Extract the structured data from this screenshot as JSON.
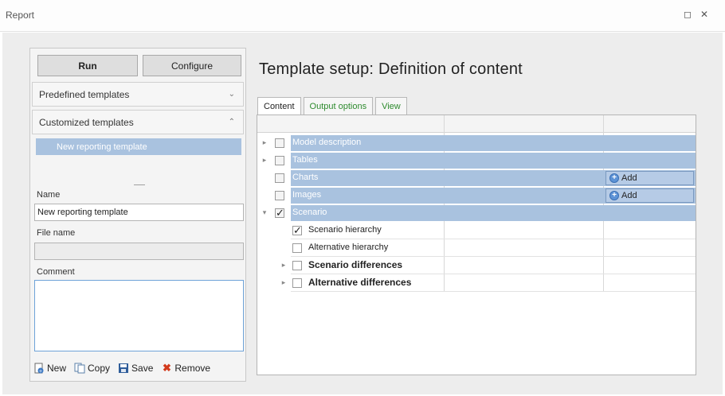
{
  "window": {
    "title": "Report",
    "restore_glyph": "◻",
    "close_glyph": "✕"
  },
  "left": {
    "run_label": "Run",
    "configure_label": "Configure",
    "predefined_label": "Predefined templates",
    "predefined_chevron": "⌄",
    "customized_label": "Customized templates",
    "customized_chevron": "⌃",
    "templates": [
      "New reporting template"
    ],
    "name_label": "Name",
    "name_value": "New reporting template",
    "filename_label": "File name",
    "filename_value": "",
    "comment_label": "Comment",
    "comment_value": "",
    "actions": {
      "new": "New",
      "copy": "Copy",
      "save": "Save",
      "remove": "Remove"
    }
  },
  "main": {
    "heading": "Template setup: Definition of content",
    "tabs": [
      "Content",
      "Output options",
      "View"
    ],
    "add_label": "Add",
    "tree": [
      {
        "label": "Model description",
        "checked": false,
        "expander": "▸",
        "selected": true
      },
      {
        "label": "Tables",
        "checked": false,
        "expander": "▸",
        "selected": true
      },
      {
        "label": "Charts",
        "checked": false,
        "expander": "",
        "selected": true,
        "add": true
      },
      {
        "label": "Images",
        "checked": false,
        "expander": "",
        "selected": true,
        "add": true
      },
      {
        "label": "Scenario",
        "checked": true,
        "expander": "▾",
        "selected": true
      },
      {
        "label": "Scenario hierarchy",
        "checked": true,
        "expander": "",
        "selected": false
      },
      {
        "label": "Alternative hierarchy",
        "checked": false,
        "expander": "",
        "selected": false
      },
      {
        "label": "Scenario differences",
        "checked": false,
        "expander": "▸",
        "selected": false,
        "bold": true
      },
      {
        "label": "Alternative differences",
        "checked": false,
        "expander": "▸",
        "selected": false,
        "bold": true
      }
    ]
  },
  "colors": {
    "selection": "#a9c2df",
    "tab_text": "#2e8b2e",
    "comment_border": "#6fa3d8"
  }
}
